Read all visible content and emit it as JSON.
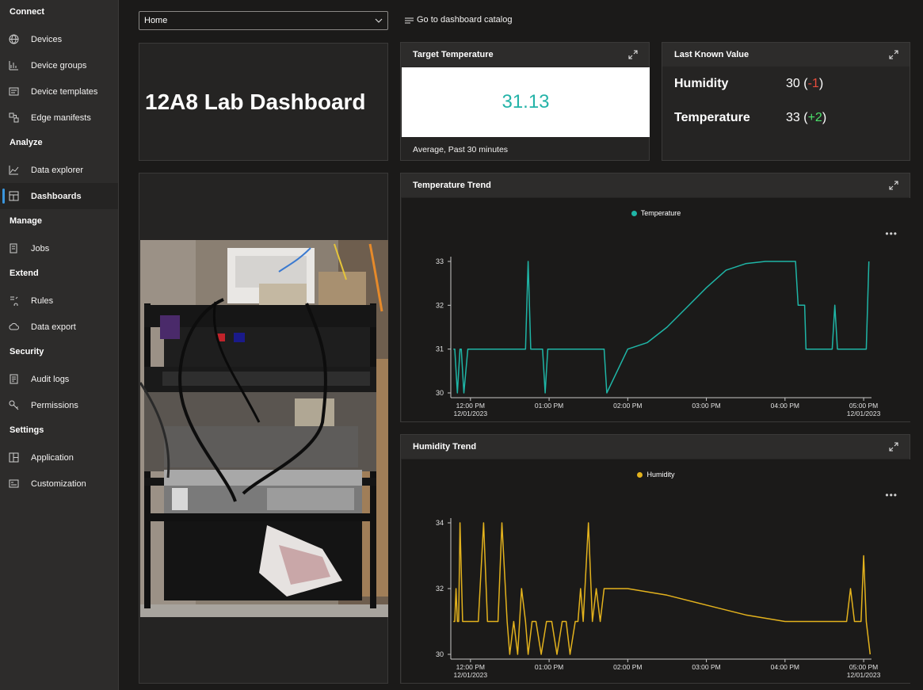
{
  "sidebar": {
    "sections": [
      {
        "label": "Connect",
        "items": [
          {
            "label": "Devices",
            "icon": "globe-icon"
          },
          {
            "label": "Device groups",
            "icon": "device-groups-icon"
          },
          {
            "label": "Device templates",
            "icon": "device-template-icon"
          },
          {
            "label": "Edge manifests",
            "icon": "edge-manifest-icon"
          }
        ]
      },
      {
        "label": "Analyze",
        "items": [
          {
            "label": "Data explorer",
            "icon": "line-chart-icon"
          },
          {
            "label": "Dashboards",
            "icon": "dashboard-icon",
            "active": true
          }
        ]
      },
      {
        "label": "Manage",
        "items": [
          {
            "label": "Jobs",
            "icon": "jobs-icon"
          }
        ]
      },
      {
        "label": "Extend",
        "items": [
          {
            "label": "Rules",
            "icon": "rules-icon"
          },
          {
            "label": "Data export",
            "icon": "cloud-export-icon"
          }
        ]
      },
      {
        "label": "Security",
        "items": [
          {
            "label": "Audit logs",
            "icon": "audit-log-icon"
          },
          {
            "label": "Permissions",
            "icon": "key-icon"
          }
        ]
      },
      {
        "label": "Settings",
        "items": [
          {
            "label": "Application",
            "icon": "application-icon"
          },
          {
            "label": "Customization",
            "icon": "customization-icon"
          }
        ]
      }
    ]
  },
  "toolbar": {
    "dashboard_select": "Home",
    "catalog_link": "Go to dashboard catalog"
  },
  "tiles": {
    "title": "12A8 Lab Dashboard",
    "kpi": {
      "header": "Target Temperature",
      "value": "31.13",
      "caption": "Average, Past 30 minutes"
    },
    "last_known": {
      "header": "Last Known Value",
      "rows": [
        {
          "name": "Humidity",
          "value": "30",
          "open": " (",
          "delta": "-1",
          "close": ")",
          "delta_sign": "neg"
        },
        {
          "name": "Temperature",
          "value": "33",
          "open": " (",
          "delta": "+2",
          "close": ")",
          "delta_sign": "pos"
        }
      ]
    },
    "temperature_trend": {
      "header": "Temperature Trend"
    },
    "humidity_trend": {
      "header": "Humidity Trend"
    }
  },
  "colors": {
    "accent": "#3a96dd",
    "temperature_series": "#1fb5a6",
    "humidity_series": "#e3b21d",
    "kpi_value": "#24b3a8",
    "delta_negative": "#e74c3c",
    "delta_positive": "#4ce06a"
  },
  "chart_data": [
    {
      "type": "line",
      "title": "Temperature Trend",
      "series": [
        {
          "name": "Temperature",
          "color": "#1fb5a6",
          "x": [
            "11:47",
            "11:48",
            "11:50",
            "11:52",
            "11:53",
            "11:55",
            "11:58",
            "12:00",
            "12:40",
            "12:42",
            "12:44",
            "12:46",
            "12:48",
            "12:50",
            "12:55",
            "12:57",
            "12:59",
            "13:00",
            "13:40",
            "13:42",
            "13:44",
            "14:00",
            "14:15",
            "14:30",
            "14:45",
            "15:00",
            "15:15",
            "15:30",
            "15:45",
            "16:00",
            "16:08",
            "16:10",
            "16:12",
            "16:15",
            "16:16",
            "16:18",
            "16:20",
            "16:24",
            "16:36",
            "16:38",
            "16:40",
            "16:42",
            "17:02",
            "17:04"
          ],
          "y": [
            31,
            31,
            30,
            31,
            31,
            30,
            31,
            31,
            31,
            31,
            33,
            31,
            31,
            31,
            31,
            30,
            31,
            31,
            31,
            31,
            30,
            31,
            31.15,
            31.5,
            31.95,
            32.4,
            32.8,
            32.95,
            33,
            33,
            33,
            32,
            32,
            32,
            31,
            31,
            31,
            31,
            31,
            32,
            31,
            31,
            31,
            33
          ]
        }
      ],
      "x_ticks": [
        "12:00 PM\n12/01/2023",
        "01:00 PM",
        "02:00 PM",
        "03:00 PM",
        "04:00 PM",
        "05:00 PM\n12/01/2023"
      ],
      "y_ticks": [
        "30",
        "31",
        "32",
        "33"
      ],
      "ylim": [
        30,
        33
      ],
      "grid": false,
      "legend": "top-center"
    },
    {
      "type": "line",
      "title": "Humidity Trend",
      "series": [
        {
          "name": "Humidity",
          "color": "#e3b21d",
          "x": [
            "11:47",
            "11:48",
            "11:49",
            "11:50",
            "11:51",
            "11:52",
            "11:54",
            "11:55",
            "11:58",
            "12:06",
            "12:10",
            "12:13",
            "12:16",
            "12:21",
            "12:24",
            "12:28",
            "12:30",
            "12:33",
            "12:36",
            "12:39",
            "12:42",
            "12:44",
            "12:47",
            "12:50",
            "12:54",
            "12:58",
            "13:02",
            "13:06",
            "13:10",
            "13:13",
            "13:16",
            "13:20",
            "13:22",
            "13:24",
            "13:26",
            "13:30",
            "13:33",
            "13:36",
            "13:39",
            "13:42",
            "13:45",
            "14:00",
            "14:30",
            "15:00",
            "15:30",
            "16:00",
            "16:30",
            "16:47",
            "16:50",
            "16:53",
            "16:58",
            "17:00",
            "17:02",
            "17:05"
          ],
          "y": [
            31,
            31,
            32,
            31,
            31,
            34,
            31,
            31,
            31,
            31,
            34,
            31,
            31,
            31,
            34,
            31,
            30,
            31,
            30,
            32,
            31,
            30,
            31,
            31,
            30,
            31,
            31,
            30,
            31,
            31,
            30,
            31,
            31,
            32,
            31,
            34,
            31,
            32,
            31,
            32,
            32,
            32,
            31.8,
            31.5,
            31.2,
            31,
            31,
            31,
            32,
            31,
            31,
            33,
            31,
            30
          ]
        }
      ],
      "x_ticks": [
        "12:00 PM\n12/01/2023",
        "01:00 PM",
        "02:00 PM",
        "03:00 PM",
        "04:00 PM",
        "05:00 PM\n12/01/2023"
      ],
      "y_ticks": [
        "30",
        "32",
        "34"
      ],
      "ylim": [
        30,
        34
      ],
      "grid": false,
      "legend": "top-center"
    }
  ]
}
